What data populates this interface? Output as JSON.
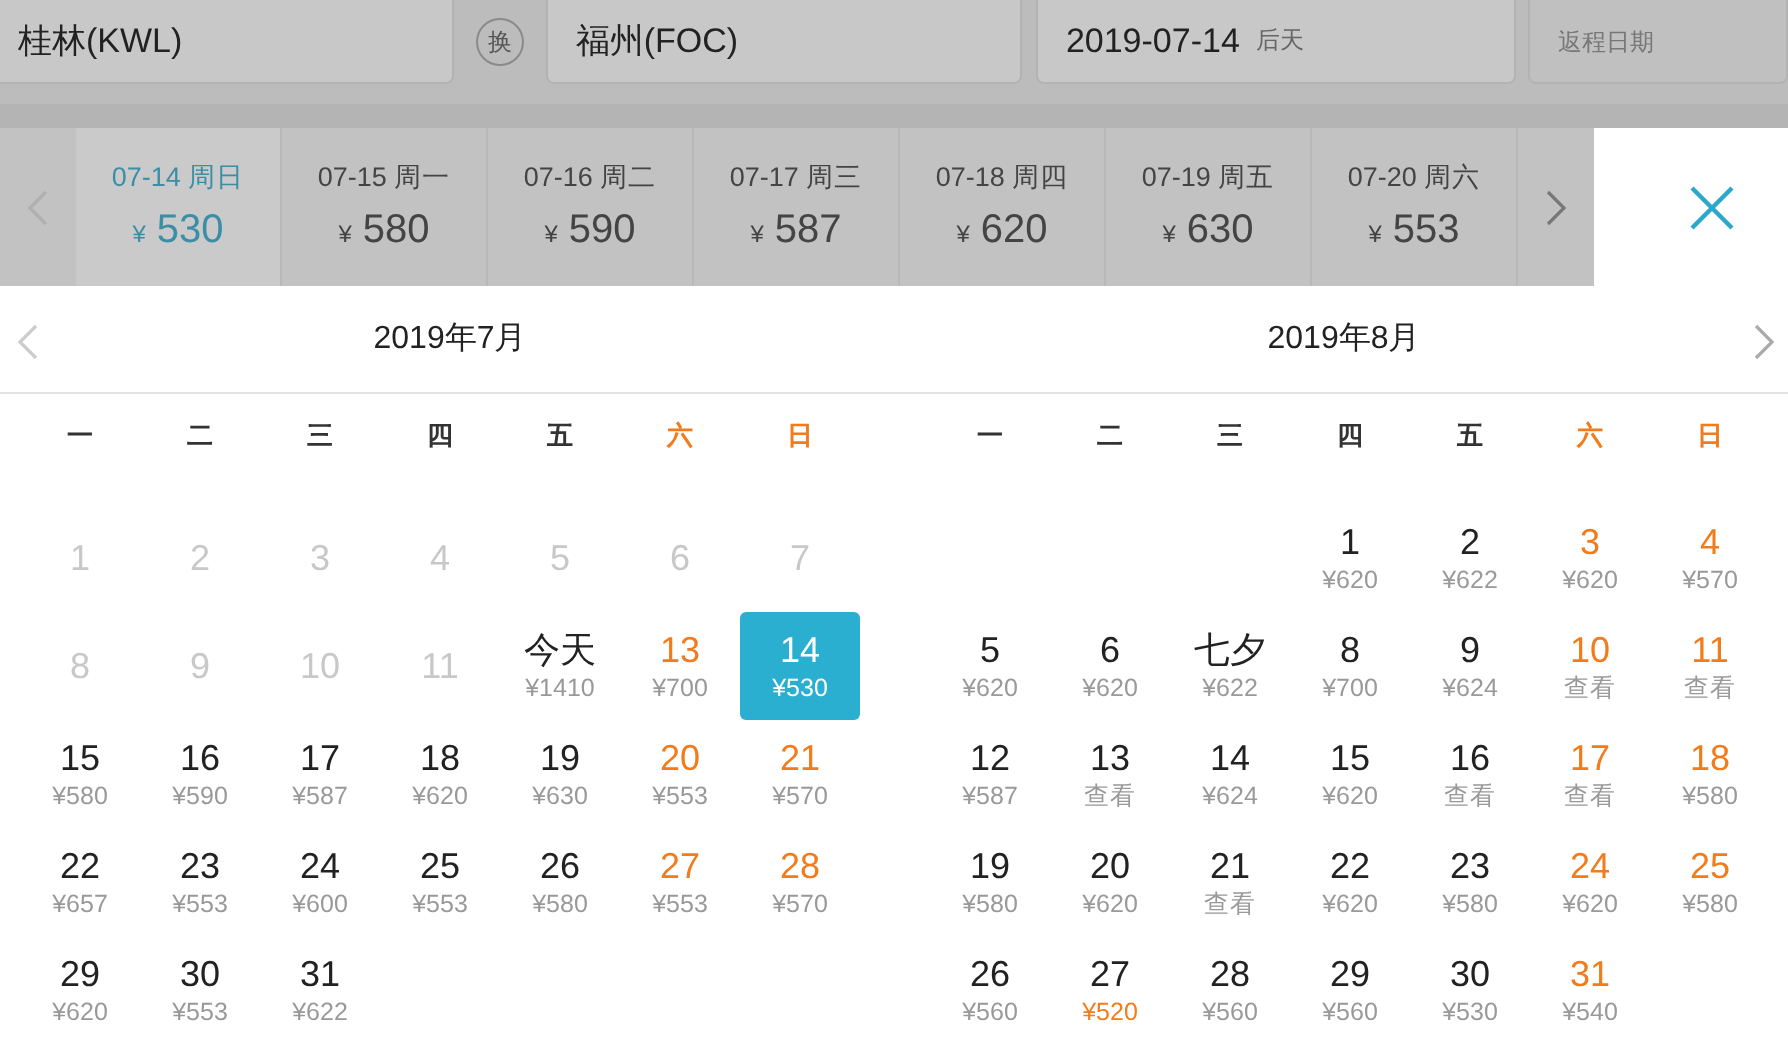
{
  "search_form": {
    "from": "桂林(KWL)",
    "swap": "换",
    "to": "福州(FOC)",
    "depart_date": "2019-07-14",
    "depart_note": "后天",
    "return_placeholder": "返程日期"
  },
  "date_strip": {
    "currency": "¥",
    "items": [
      {
        "date": "07-14 周日",
        "price": "530",
        "selected": true
      },
      {
        "date": "07-15 周一",
        "price": "580",
        "selected": false
      },
      {
        "date": "07-16 周二",
        "price": "590",
        "selected": false
      },
      {
        "date": "07-17 周三",
        "price": "587",
        "selected": false
      },
      {
        "date": "07-18 周四",
        "price": "620",
        "selected": false
      },
      {
        "date": "07-19 周五",
        "price": "630",
        "selected": false
      },
      {
        "date": "07-20 周六",
        "price": "553",
        "selected": false
      }
    ]
  },
  "months": [
    {
      "title": "2019年7月",
      "weekdays": [
        {
          "label": "一",
          "weekend": false
        },
        {
          "label": "二",
          "weekend": false
        },
        {
          "label": "三",
          "weekend": false
        },
        {
          "label": "四",
          "weekend": false
        },
        {
          "label": "五",
          "weekend": false
        },
        {
          "label": "六",
          "weekend": true
        },
        {
          "label": "日",
          "weekend": true
        }
      ],
      "weeks": [
        [
          {
            "day": "1",
            "past": true
          },
          {
            "day": "2",
            "past": true
          },
          {
            "day": "3",
            "past": true
          },
          {
            "day": "4",
            "past": true
          },
          {
            "day": "5",
            "past": true
          },
          {
            "day": "6",
            "past": true
          },
          {
            "day": "7",
            "past": true
          }
        ],
        [
          {
            "day": "8",
            "past": true
          },
          {
            "day": "9",
            "past": true
          },
          {
            "day": "10",
            "past": true
          },
          {
            "day": "11",
            "past": true
          },
          {
            "day": "今天",
            "price": "¥1410"
          },
          {
            "day": "13",
            "price": "¥700",
            "weekend": true
          },
          {
            "day": "14",
            "price": "¥530",
            "weekend": true,
            "selected": true
          }
        ],
        [
          {
            "day": "15",
            "price": "¥580"
          },
          {
            "day": "16",
            "price": "¥590"
          },
          {
            "day": "17",
            "price": "¥587"
          },
          {
            "day": "18",
            "price": "¥620"
          },
          {
            "day": "19",
            "price": "¥630"
          },
          {
            "day": "20",
            "price": "¥553",
            "weekend": true
          },
          {
            "day": "21",
            "price": "¥570",
            "weekend": true
          }
        ],
        [
          {
            "day": "22",
            "price": "¥657"
          },
          {
            "day": "23",
            "price": "¥553"
          },
          {
            "day": "24",
            "price": "¥600"
          },
          {
            "day": "25",
            "price": "¥553"
          },
          {
            "day": "26",
            "price": "¥580"
          },
          {
            "day": "27",
            "price": "¥553",
            "weekend": true
          },
          {
            "day": "28",
            "price": "¥570",
            "weekend": true
          }
        ],
        [
          {
            "day": "29",
            "price": "¥620"
          },
          {
            "day": "30",
            "price": "¥553"
          },
          {
            "day": "31",
            "price": "¥622"
          }
        ]
      ]
    },
    {
      "title": "2019年8月",
      "weekdays": [
        {
          "label": "一",
          "weekend": false
        },
        {
          "label": "二",
          "weekend": false
        },
        {
          "label": "三",
          "weekend": false
        },
        {
          "label": "四",
          "weekend": false
        },
        {
          "label": "五",
          "weekend": false
        },
        {
          "label": "六",
          "weekend": true
        },
        {
          "label": "日",
          "weekend": true
        }
      ],
      "weeks": [
        [
          {
            "day": "1",
            "price": "¥620"
          },
          {
            "day": "2",
            "price": "¥622"
          },
          {
            "day": "3",
            "price": "¥620",
            "weekend": true
          },
          {
            "day": "4",
            "price": "¥570",
            "weekend": true
          }
        ],
        [
          {
            "day": "5",
            "price": "¥620"
          },
          {
            "day": "6",
            "price": "¥620"
          },
          {
            "day": "七夕",
            "price": "¥622"
          },
          {
            "day": "8",
            "price": "¥700"
          },
          {
            "day": "9",
            "price": "¥624"
          },
          {
            "day": "10",
            "price": "查看",
            "weekend": true
          },
          {
            "day": "11",
            "price": "查看",
            "weekend": true
          }
        ],
        [
          {
            "day": "12",
            "price": "¥587"
          },
          {
            "day": "13",
            "price": "查看"
          },
          {
            "day": "14",
            "price": "¥624"
          },
          {
            "day": "15",
            "price": "¥620"
          },
          {
            "day": "16",
            "price": "查看"
          },
          {
            "day": "17",
            "price": "查看",
            "weekend": true
          },
          {
            "day": "18",
            "price": "¥580",
            "weekend": true
          }
        ],
        [
          {
            "day": "19",
            "price": "¥580"
          },
          {
            "day": "20",
            "price": "¥620"
          },
          {
            "day": "21",
            "price": "查看"
          },
          {
            "day": "22",
            "price": "¥620"
          },
          {
            "day": "23",
            "price": "¥580"
          },
          {
            "day": "24",
            "price": "¥620",
            "weekend": true
          },
          {
            "day": "25",
            "price": "¥580",
            "weekend": true
          }
        ],
        [
          {
            "day": "26",
            "price": "¥560"
          },
          {
            "day": "27",
            "price": "¥520",
            "lowest": true
          },
          {
            "day": "28",
            "price": "¥560"
          },
          {
            "day": "29",
            "price": "¥560"
          },
          {
            "day": "30",
            "price": "¥530"
          },
          {
            "day": "31",
            "price": "¥540",
            "weekend": true
          }
        ]
      ]
    }
  ]
}
